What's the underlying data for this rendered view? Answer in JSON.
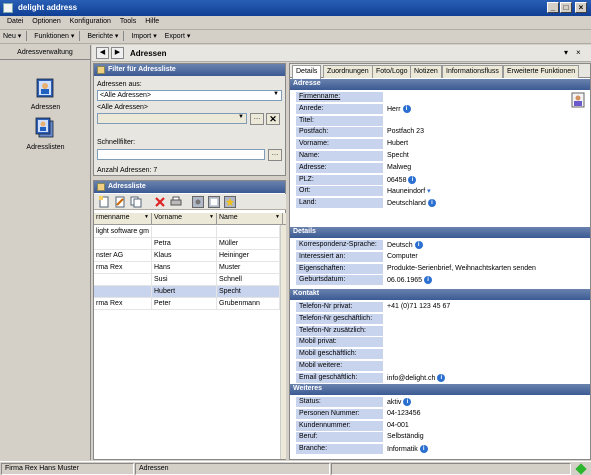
{
  "window": {
    "title": "delight address"
  },
  "menu": [
    "Datei",
    "Optionen",
    "Konfiguration",
    "Tools",
    "Hilfe"
  ],
  "toolbar": {
    "neu": "Neu ▾",
    "funktionen": "Funktionen ▾",
    "berichte": "Berichte ▾",
    "import": "Import ▾",
    "export": "Export ▾"
  },
  "nav": {
    "header": "Adressverwaltung",
    "items": [
      {
        "label": "Adressen",
        "icon": "address-book-icon"
      },
      {
        "label": "Adresslisten",
        "icon": "address-list-icon"
      }
    ]
  },
  "content_header": {
    "title": "Adressen"
  },
  "filter": {
    "title": "Filter für Adressliste",
    "source_label": "Adressen aus:",
    "source_value": "<Alle Adressen>",
    "sub_label": "<Alle Adressen>",
    "quick_label": "Schnellfilter:",
    "quick_value": "",
    "count": "Anzahl Adressen: 7"
  },
  "list": {
    "title": "Adressliste",
    "columns": [
      "rmenname",
      "Vorname",
      "Name"
    ],
    "rows": [
      [
        "light software gm",
        "",
        ""
      ],
      [
        "",
        "Petra",
        "Müller"
      ],
      [
        "nster AG",
        "Klaus",
        "Heininger"
      ],
      [
        "rma Rex",
        "Hans",
        "Muster"
      ],
      [
        "",
        "Susi",
        "Schnell"
      ],
      [
        "",
        "Hubert",
        "Specht"
      ],
      [
        "rma Rex",
        "Peter",
        "Grubenmann"
      ]
    ]
  },
  "detail": {
    "tabs": [
      "Details",
      "Zuordnungen",
      "Foto/Logo",
      "Notizen",
      "Informationsfluss",
      "Erweiterte Funktionen"
    ],
    "sections": {
      "adresse": {
        "title": "Adresse",
        "fields": [
          {
            "label": "Firmenname:",
            "value": ""
          },
          {
            "label": "Anrede:",
            "value": "Herr"
          },
          {
            "label": "Titel:",
            "value": ""
          },
          {
            "label": "Postfach:",
            "value": "Postfach 23"
          },
          {
            "label": "Vorname:",
            "value": "Hubert"
          },
          {
            "label": "Name:",
            "value": "Specht"
          },
          {
            "label": "Adresse:",
            "value": "Malweg"
          },
          {
            "label": "PLZ:",
            "value": "06458"
          },
          {
            "label": "Ort:",
            "value": "Hauneindorf"
          },
          {
            "label": "Land:",
            "value": "Deutschland"
          }
        ]
      },
      "details": {
        "title": "Details",
        "fields": [
          {
            "label": "Korrespondenz-Sprache:",
            "value": "Deutsch"
          },
          {
            "label": "Interessiert an:",
            "value": "Computer"
          },
          {
            "label": "Eigenschaften:",
            "value": "Produkte-Serienbrief, Weihnachtskarten senden"
          },
          {
            "label": "Geburtsdatum:",
            "value": "06.06.1965"
          }
        ]
      },
      "kontakt": {
        "title": "Kontakt",
        "fields": [
          {
            "label": "Telefon-Nr privat:",
            "value": "+41 (0)71 123 45 67"
          },
          {
            "label": "Telefon-Nr geschäftlich:",
            "value": ""
          },
          {
            "label": "Telefon-Nr zusätzlich:",
            "value": ""
          },
          {
            "label": "Mobil privat:",
            "value": ""
          },
          {
            "label": "Mobil geschäftlich:",
            "value": ""
          },
          {
            "label": "Mobil weitere:",
            "value": ""
          },
          {
            "label": "Email geschäftlich:",
            "value": "info@delight.ch"
          }
        ]
      },
      "weiteres": {
        "title": "Weiteres",
        "fields": [
          {
            "label": "Status:",
            "value": "aktiv"
          },
          {
            "label": "Personen Nummer:",
            "value": "04-123456"
          },
          {
            "label": "Kundennummer:",
            "value": "04-001"
          },
          {
            "label": "Beruf:",
            "value": "Selbständig"
          },
          {
            "label": "Branche:",
            "value": "Informatik"
          }
        ]
      }
    }
  },
  "status": {
    "user": "Firma Rex Hans Muster",
    "module": "Adressen"
  },
  "colors": {
    "accent": "#3b5a94",
    "label_bg": "#c8d4ee",
    "selected_row": "#c8d4ee"
  }
}
